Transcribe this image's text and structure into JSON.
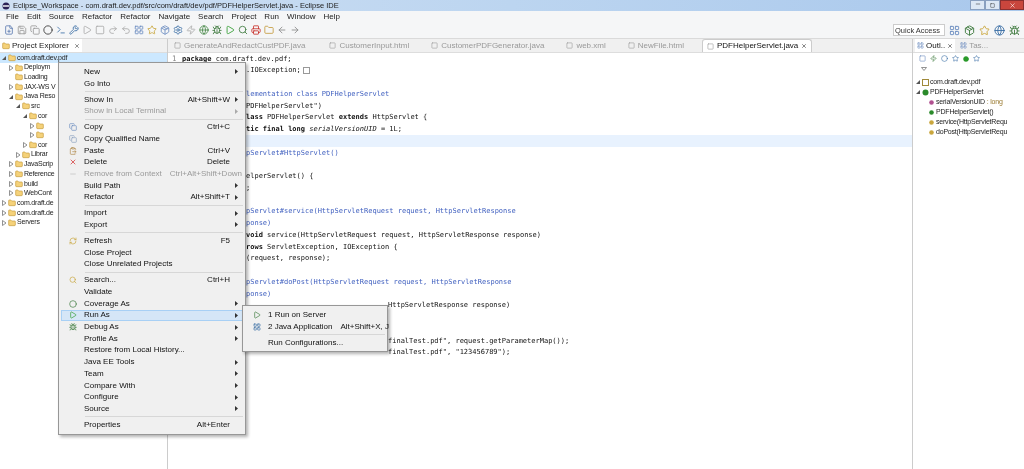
{
  "window": {
    "title": "Eclipse_Workspace - com.draft.dev.pdf/src/com/draft/dev/pdf/PDFHelperServlet.java - Eclipse IDE"
  },
  "menu_bar": [
    "File",
    "Edit",
    "Source",
    "Refactor",
    "Refactor",
    "Navigate",
    "Search",
    "Project",
    "Run",
    "Window",
    "Help"
  ],
  "quick_access": {
    "placeholder": "Quick Access"
  },
  "project_explorer": {
    "title": "Project Explorer",
    "tree": [
      {
        "label": "com.draft.dev.pdf",
        "selected": true,
        "expanded": true,
        "children": [
          {
            "label": "Deploym",
            "selected": false,
            "expanded": false
          },
          {
            "label": "Loading",
            "selected": false
          },
          {
            "label": "JAX-WS V",
            "selected": false,
            "expanded": false
          },
          {
            "label": "Java Reso",
            "selected": false,
            "expanded": true,
            "children": [
              {
                "label": "src",
                "selected": false,
                "expanded": true,
                "children": [
                  {
                    "label": "cor",
                    "selected": false,
                    "expanded": true,
                    "children": [
                      {
                        "selected": false,
                        "expanded": false
                      },
                      {
                        "selected": false,
                        "expanded": false
                      }
                    ]
                  },
                  {
                    "label": "cor",
                    "selected": false,
                    "expanded": false
                  }
                ]
              },
              {
                "label": "Librar",
                "selected": false,
                "expanded": false
              }
            ]
          },
          {
            "label": "JavaScrip",
            "selected": false,
            "expanded": false
          },
          {
            "label": "Reference",
            "selected": false,
            "expanded": false
          },
          {
            "label": "build",
            "selected": false,
            "expanded": false
          },
          {
            "label": "WebCont",
            "selected": false,
            "expanded": false
          }
        ]
      },
      {
        "label": "com.draft.de",
        "selected": false,
        "expanded": false
      },
      {
        "label": "com.draft.de",
        "selected": false,
        "expanded": false
      },
      {
        "label": "Servers",
        "selected": false,
        "expanded": false
      }
    ]
  },
  "editor": {
    "tabs": [
      {
        "label": "GenerateAndRedactCustPDF.java",
        "selected": false
      },
      {
        "label": "CustomerInput.html",
        "selected": false
      },
      {
        "label": "CustomerPDFGenerator.java",
        "selected": false
      },
      {
        "label": "web.xml",
        "selected": false
      },
      {
        "label": "NewFile.html",
        "selected": false
      },
      {
        "label": "PDFHelperServlet.java",
        "selected": true
      }
    ],
    "lines": [
      {
        "kind": "full",
        "number": "1",
        "text": "**package** com.draft.dev.pdf;",
        "comment": false,
        "current": false
      },
      {
        "kind": "after_menu",
        "text": ".IOException;",
        "comment": false,
        "folded": true,
        "current": false
      },
      {
        "kind": "blank",
        "current": false
      },
      {
        "kind": "after_menu",
        "text": "lementation class PDFHelperServlet",
        "comment": true,
        "current": false
      },
      {
        "kind": "after_menu",
        "text": "PDFHelperServlet\")",
        "comment": false,
        "current": false
      },
      {
        "kind": "after_menu",
        "text": "**lass** PDFHelperServlet **extends** HttpServlet {",
        "comment": false,
        "current": false
      },
      {
        "kind": "after_menu",
        "text": "**tic final long** *serialVersionUID* = 1L;",
        "comment": false,
        "current": false
      },
      {
        "kind": "blank",
        "current": true
      },
      {
        "kind": "after_menu",
        "text": "pServlet#HttpServlet()",
        "comment": true,
        "current": false
      },
      {
        "kind": "blank",
        "current": false
      },
      {
        "kind": "after_menu",
        "text": "elperServlet() {",
        "comment": false,
        "current": false
      },
      {
        "kind": "after_menu",
        "text": ";",
        "comment": false,
        "current": false
      },
      {
        "kind": "blank",
        "current": false
      },
      {
        "kind": "after_menu",
        "text": "pServlet#service(HttpServletRequest request, HttpServletResponse",
        "comment": true,
        "current": false
      },
      {
        "kind": "after_menu",
        "text": "ponse)",
        "comment": true,
        "current": false
      },
      {
        "kind": "after_menu",
        "text": "**void** service(HttpServletRequest request, HttpServletResponse response)",
        "comment": false,
        "current": false
      },
      {
        "kind": "after_menu",
        "text": "**rows** ServletException, IOException {",
        "comment": false,
        "current": false
      },
      {
        "kind": "after_menu",
        "text": "(request, response);",
        "comment": false,
        "current": false
      },
      {
        "kind": "blank",
        "current": false
      },
      {
        "kind": "after_menu",
        "text": "pServlet#doPost(HttpServletRequest request, HttpServletResponse",
        "comment": true,
        "current": false
      },
      {
        "kind": "after_menu",
        "text": "ponse)",
        "comment": true,
        "current": false
      },
      {
        "kind": "after_submenu",
        "text": "HttpServletResponse response)",
        "comment": false,
        "current": false
      },
      {
        "kind": "blank",
        "current": false
      },
      {
        "kind": "blank",
        "current": false
      },
      {
        "kind": "after_submenu",
        "text": "finalTest.pdf\", request.getParameterMap());",
        "comment": false,
        "current": false
      },
      {
        "kind": "after_submenu",
        "text": "finalTest.pdf\", \"123456789\");",
        "comment": false,
        "current": false
      }
    ]
  },
  "outline": {
    "tabs": [
      {
        "label": "Outl..",
        "selected": true
      },
      {
        "label": "Tas...",
        "selected": false
      }
    ],
    "tree": [
      {
        "label": "com.draft.dev.pdf",
        "kind": "package",
        "expanded": true
      },
      {
        "label": "PDFHelperServlet",
        "kind": "class",
        "expanded": true,
        "children": [
          {
            "label": "serialVersionUID",
            "type": ": long",
            "kind": "field"
          },
          {
            "label": "PDFHelperServlet()",
            "kind": "constructor"
          },
          {
            "label": "service(HttpServletRequ",
            "kind": "method"
          },
          {
            "label": "doPost(HttpServletRequ",
            "kind": "method"
          }
        ]
      }
    ]
  },
  "context_menu": [
    {
      "kind": "item",
      "label": "New",
      "submenu": true,
      "disabled": false,
      "selected": false
    },
    {
      "kind": "item",
      "label": "Go Into",
      "submenu": false,
      "disabled": false,
      "selected": false
    },
    {
      "kind": "separator"
    },
    {
      "kind": "item",
      "label": "Show In",
      "shortcut": "Alt+Shift+W",
      "submenu": true,
      "disabled": false,
      "selected": false
    },
    {
      "kind": "item",
      "label": "Show in Local Terminal",
      "submenu": true,
      "disabled": true,
      "selected": false
    },
    {
      "kind": "separator"
    },
    {
      "kind": "item",
      "label": "Copy",
      "shortcut": "Ctrl+C",
      "submenu": false,
      "disabled": false,
      "selected": false
    },
    {
      "kind": "item",
      "label": "Copy Qualified Name",
      "submenu": false,
      "disabled": false,
      "selected": false
    },
    {
      "kind": "item",
      "label": "Paste",
      "shortcut": "Ctrl+V",
      "submenu": false,
      "disabled": false,
      "selected": false
    },
    {
      "kind": "item",
      "label": "Delete",
      "shortcut": "Delete",
      "submenu": false,
      "disabled": false,
      "selected": false
    },
    {
      "kind": "item",
      "label": "Remove from Context",
      "shortcut": "Ctrl+Alt+Shift+Down",
      "submenu": false,
      "disabled": true,
      "selected": false
    },
    {
      "kind": "item",
      "label": "Build Path",
      "submenu": true,
      "disabled": false,
      "selected": false
    },
    {
      "kind": "item",
      "label": "Refactor",
      "shortcut": "Alt+Shift+T",
      "submenu": true,
      "disabled": false,
      "selected": false
    },
    {
      "kind": "separator"
    },
    {
      "kind": "item",
      "label": "Import",
      "submenu": true,
      "disabled": false,
      "selected": false
    },
    {
      "kind": "item",
      "label": "Export",
      "submenu": true,
      "disabled": false,
      "selected": false
    },
    {
      "kind": "separator"
    },
    {
      "kind": "item",
      "label": "Refresh",
      "shortcut": "F5",
      "submenu": false,
      "disabled": false,
      "selected": false
    },
    {
      "kind": "item",
      "label": "Close Project",
      "submenu": false,
      "disabled": false,
      "selected": false
    },
    {
      "kind": "item",
      "label": "Close Unrelated Projects",
      "submenu": false,
      "disabled": false,
      "selected": false
    },
    {
      "kind": "separator"
    },
    {
      "kind": "item",
      "label": "Search...",
      "shortcut": "Ctrl+H",
      "submenu": false,
      "disabled": false,
      "selected": false
    },
    {
      "kind": "item",
      "label": "Validate",
      "submenu": false,
      "disabled": false,
      "selected": false
    },
    {
      "kind": "item",
      "label": "Coverage As",
      "submenu": true,
      "disabled": false,
      "selected": false
    },
    {
      "kind": "item",
      "label": "Run As",
      "submenu": true,
      "disabled": false,
      "selected": true
    },
    {
      "kind": "item",
      "label": "Debug As",
      "submenu": true,
      "disabled": false,
      "selected": false
    },
    {
      "kind": "item",
      "label": "Profile As",
      "submenu": true,
      "disabled": false,
      "selected": false
    },
    {
      "kind": "item",
      "label": "Restore from Local History...",
      "submenu": false,
      "disabled": false,
      "selected": false
    },
    {
      "kind": "item",
      "label": "Java EE Tools",
      "submenu": true,
      "disabled": false,
      "selected": false
    },
    {
      "kind": "item",
      "label": "Team",
      "submenu": true,
      "disabled": false,
      "selected": false
    },
    {
      "kind": "item",
      "label": "Compare With",
      "submenu": true,
      "disabled": false,
      "selected": false
    },
    {
      "kind": "item",
      "label": "Configure",
      "submenu": true,
      "disabled": false,
      "selected": false
    },
    {
      "kind": "item",
      "label": "Source",
      "submenu": true,
      "disabled": false,
      "selected": false
    },
    {
      "kind": "separator"
    },
    {
      "kind": "item",
      "label": "Properties",
      "shortcut": "Alt+Enter",
      "submenu": false,
      "disabled": false,
      "selected": false
    }
  ],
  "run_as_submenu": [
    {
      "kind": "item",
      "label": "1 Run on Server",
      "selected": false
    },
    {
      "kind": "item",
      "label": "2 Java Application",
      "shortcut": "Alt+Shift+X, J",
      "selected": false
    },
    {
      "kind": "separator"
    },
    {
      "kind": "item",
      "label": "Run Configurations...",
      "selected": false
    }
  ]
}
